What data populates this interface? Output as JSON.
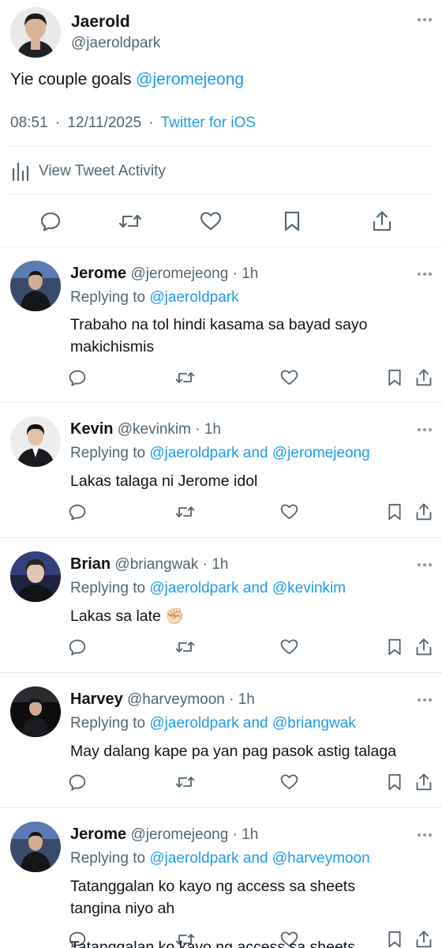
{
  "main_tweet": {
    "name": "Jaerold",
    "handle": "@jaeroldpark",
    "text_plain": "Yie couple goals ",
    "text_mention": "@jeromejeong",
    "time": "08:51",
    "date": "12/11/2025",
    "separator": "·",
    "source": "Twitter for iOS",
    "activity_label": "View Tweet Activity"
  },
  "replies": [
    {
      "name": "Jerome",
      "handle": "@jeromejeong",
      "age": "· 1h",
      "replying_prefix": "Replying to ",
      "replying_to": "@jaeroldpark",
      "text": "Trabaho na tol hindi kasama sa bayad sayo makichismis"
    },
    {
      "name": "Kevin",
      "handle": "@kevinkim",
      "age": "· 1h",
      "replying_prefix": "Replying to ",
      "replying_to": "@jaeroldpark and @jeromejeong",
      "text": "Lakas talaga ni Jerome idol"
    },
    {
      "name": "Brian",
      "handle": "@briangwak",
      "age": "· 1h",
      "replying_prefix": "Replying to ",
      "replying_to": "@jaeroldpark and @kevinkim",
      "text": "Lakas sa late ✊🏻"
    },
    {
      "name": "Harvey",
      "handle": "@harveymoon",
      "age": "· 1h",
      "replying_prefix": "Replying to ",
      "replying_to": "@jaeroldpark and @briangwak",
      "text": "May dalang kape pa yan pag pasok astig talaga"
    },
    {
      "name": "Jerome",
      "handle": "@jeromejeong",
      "age": "· 1h",
      "replying_prefix": "Replying to ",
      "replying_to": "@jaeroldpark and @harveymoon",
      "text": "Tatanggalan ko kayo ng access sa sheets tangina niyo ah"
    }
  ],
  "overlap_text": "Tatanggalan ko kayo ng access sa sheets",
  "colors": {
    "accent": "#1d9bf0",
    "muted": "#536471",
    "divider": "#e6ecf0"
  },
  "icons": [
    "more-icon",
    "bar-chart-icon",
    "reply-icon",
    "retweet-icon",
    "like-icon",
    "bookmark-icon",
    "share-icon"
  ]
}
